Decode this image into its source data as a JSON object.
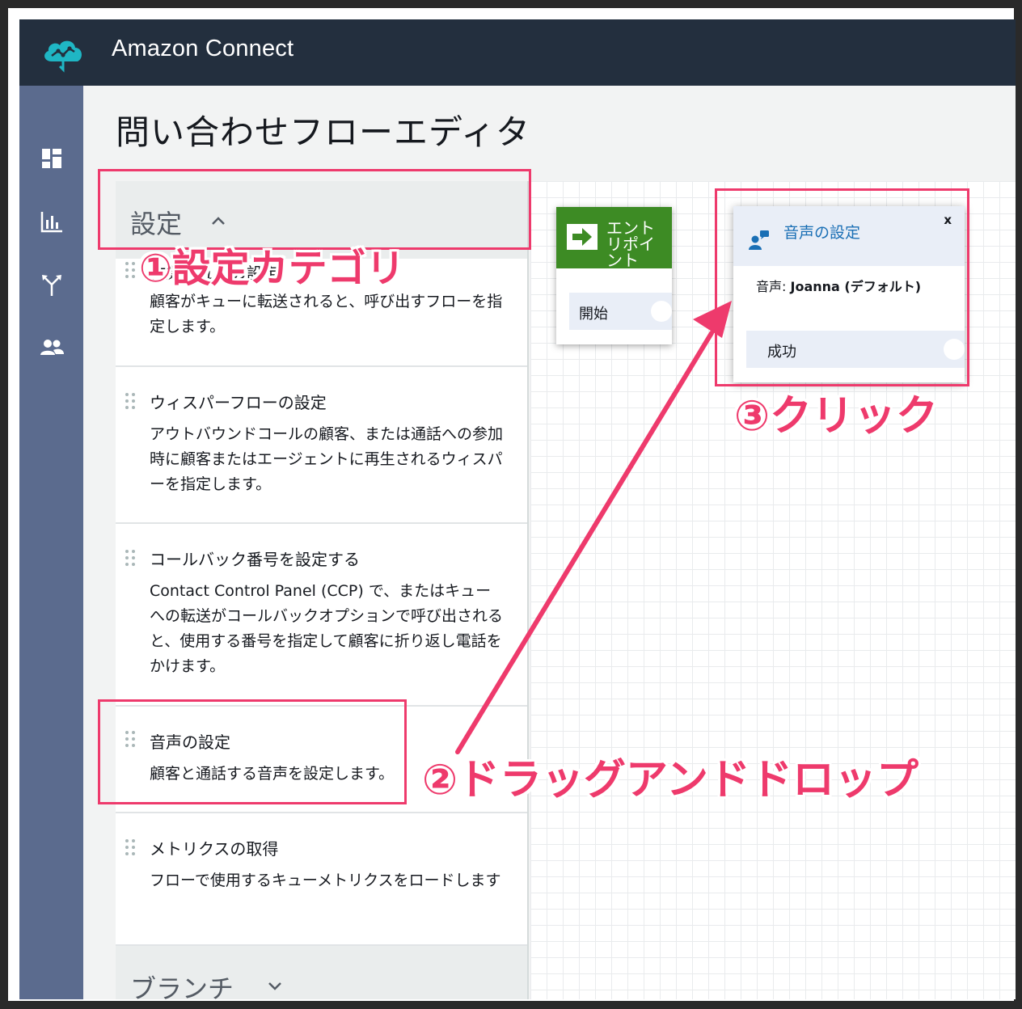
{
  "header": {
    "app_title": "Amazon Connect"
  },
  "sidenav": {
    "items": [
      {
        "icon": "dashboard-icon"
      },
      {
        "icon": "metrics-icon"
      },
      {
        "icon": "routing-icon"
      },
      {
        "icon": "users-icon"
      }
    ]
  },
  "page": {
    "title": "問い合わせフローエディタ"
  },
  "palette": {
    "settings_category": "設定",
    "branch_category": "ブランチ",
    "blocks": [
      {
        "title": "作業キューの設定",
        "description": "顧客がキューに転送されると、呼び出すフローを指定します。"
      },
      {
        "title": "ウィスパーフローの設定",
        "description": "アウトバウンドコールの顧客、または通話への参加時に顧客またはエージェントに再生されるウィスパーを指定します。"
      },
      {
        "title": "コールバック番号を設定する",
        "description": "Contact Control Panel (CCP) で、またはキューへの転送がコールバックオプションで呼び出されると、使用する番号を指定して顧客に折り返し電話をかけます。"
      },
      {
        "title": "音声の設定",
        "description": "顧客と通話する音声を設定します。"
      },
      {
        "title": "メトリクスの取得",
        "description": "フローで使用するキューメトリクスをロードします"
      }
    ]
  },
  "canvas": {
    "entry_node": {
      "title": "エントリポイント",
      "branch": "開始"
    },
    "voice_node": {
      "title": "音声の設定",
      "close": "x",
      "prop_label": "音声:",
      "prop_value": "Joanna (デフォルト)",
      "branch": "成功"
    }
  },
  "annotations": {
    "step1": "①設定カテゴリ",
    "step2": "②ドラッグアンドドロップ",
    "step3": "③クリック",
    "color": "#ee3a6c"
  },
  "colors": {
    "topbar": "#232f3e",
    "sidenav": "#5b6b8e",
    "entry_green": "#3d8b24",
    "link_blue": "#1a6fb5"
  }
}
